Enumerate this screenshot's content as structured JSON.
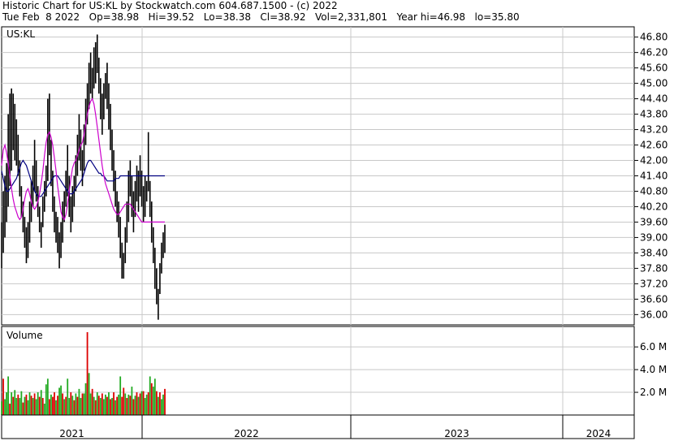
{
  "header": {
    "title": "Historic Chart for US:KL by Stockwatch.com 604.687.1500 - (c) 2022",
    "quote": "Tue Feb  8 2022   Op=38.98   Hi=39.52   Lo=38.38   Cl=38.92   Vol=2,331,801   Year hi=46.98   lo=35.80"
  },
  "colors": {
    "price": "#000000",
    "ma_short": "#cc00cc",
    "ma_long": "#000080",
    "vol_up": "#22aa22",
    "vol_down": "#dd0000",
    "grid": "#c8c8c8",
    "border": "#000000"
  },
  "chart_data": [
    {
      "type": "line",
      "title": "US:KL",
      "y_ticks": [
        "46.80",
        "46.20",
        "45.60",
        "45.00",
        "44.40",
        "43.80",
        "43.20",
        "42.60",
        "42.00",
        "41.40",
        "40.80",
        "40.20",
        "39.60",
        "39.00",
        "38.40",
        "37.80",
        "37.20",
        "36.60",
        "36.00"
      ],
      "ylim": [
        35.6,
        47.2
      ],
      "x_categories": [
        "2021",
        "2022",
        "2023",
        "2024"
      ],
      "grid": true,
      "series": [
        {
          "role": "price_range",
          "values": [
            [
              37.8,
              39.6
            ],
            [
              38.4,
              40.8
            ],
            [
              39.0,
              41.4
            ],
            [
              39.6,
              41.9
            ],
            [
              40.2,
              43.8
            ],
            [
              41.0,
              44.6
            ],
            [
              41.6,
              44.8
            ],
            [
              42.4,
              44.6
            ],
            [
              42.0,
              44.2
            ],
            [
              41.8,
              43.6
            ],
            [
              41.4,
              43.0
            ],
            [
              40.6,
              42.0
            ],
            [
              39.8,
              41.0
            ],
            [
              39.2,
              40.4
            ],
            [
              38.6,
              39.8
            ],
            [
              38.0,
              39.4
            ],
            [
              38.2,
              39.6
            ],
            [
              38.8,
              40.4
            ],
            [
              39.6,
              41.2
            ],
            [
              40.2,
              41.8
            ],
            [
              40.8,
              42.8
            ],
            [
              40.4,
              42.0
            ],
            [
              39.8,
              41.0
            ],
            [
              39.2,
              40.2
            ],
            [
              38.6,
              39.6
            ],
            [
              39.4,
              40.6
            ],
            [
              40.0,
              41.2
            ],
            [
              40.6,
              41.8
            ],
            [
              41.2,
              44.4
            ],
            [
              42.2,
              44.6
            ],
            [
              41.0,
              42.8
            ],
            [
              40.0,
              41.6
            ],
            [
              39.2,
              40.6
            ],
            [
              38.8,
              40.0
            ],
            [
              38.4,
              39.8
            ],
            [
              37.8,
              39.2
            ],
            [
              38.2,
              39.6
            ],
            [
              38.8,
              40.4
            ],
            [
              39.6,
              40.8
            ],
            [
              40.2,
              41.6
            ],
            [
              40.6,
              42.6
            ],
            [
              39.8,
              41.4
            ],
            [
              39.2,
              40.6
            ],
            [
              39.6,
              41.0
            ],
            [
              40.2,
              41.4
            ],
            [
              40.8,
              42.2
            ],
            [
              41.4,
              43.0
            ],
            [
              42.0,
              43.8
            ],
            [
              41.6,
              43.2
            ],
            [
              41.0,
              42.4
            ],
            [
              41.6,
              43.4
            ],
            [
              42.6,
              44.4
            ],
            [
              43.4,
              45.0
            ],
            [
              44.0,
              45.8
            ],
            [
              44.6,
              46.2
            ],
            [
              44.4,
              45.6
            ],
            [
              44.8,
              46.4
            ],
            [
              45.0,
              46.6
            ],
            [
              45.4,
              46.9
            ],
            [
              44.6,
              46.0
            ],
            [
              43.6,
              45.2
            ],
            [
              43.0,
              44.6
            ],
            [
              43.6,
              45.0
            ],
            [
              44.4,
              45.4
            ],
            [
              44.0,
              45.8
            ],
            [
              43.2,
              45.0
            ],
            [
              42.4,
              44.2
            ],
            [
              41.6,
              43.2
            ],
            [
              40.8,
              42.4
            ],
            [
              40.2,
              41.6
            ],
            [
              39.6,
              40.8
            ],
            [
              39.0,
              40.4
            ],
            [
              38.2,
              39.8
            ],
            [
              37.4,
              38.8
            ],
            [
              37.4,
              38.4
            ],
            [
              38.0,
              39.4
            ],
            [
              38.8,
              40.4
            ],
            [
              39.6,
              41.6
            ],
            [
              40.6,
              42.0
            ],
            [
              39.8,
              41.4
            ],
            [
              39.2,
              40.8
            ],
            [
              39.8,
              41.2
            ],
            [
              40.4,
              41.8
            ],
            [
              40.0,
              41.6
            ],
            [
              40.6,
              42.2
            ],
            [
              40.2,
              41.6
            ],
            [
              39.6,
              41.0
            ],
            [
              39.8,
              41.4
            ],
            [
              40.4,
              41.2
            ],
            [
              40.8,
              43.1
            ],
            [
              39.8,
              41.2
            ],
            [
              38.8,
              40.4
            ],
            [
              38.0,
              39.4
            ],
            [
              37.0,
              38.6
            ],
            [
              36.4,
              37.8
            ],
            [
              35.8,
              37.0
            ],
            [
              36.8,
              38.0
            ],
            [
              37.6,
              38.8
            ],
            [
              38.2,
              39.2
            ],
            [
              38.4,
              39.5
            ]
          ]
        },
        {
          "role": "moving_average_short",
          "values": [
            41.8,
            42.4,
            42.6,
            42.3,
            41.9,
            41.4,
            40.9,
            40.5,
            40.2,
            40.0,
            39.8,
            39.7,
            39.8,
            40.1,
            40.5,
            40.8,
            40.9,
            40.7,
            40.4,
            40.2,
            40.1,
            40.2,
            40.4,
            40.7,
            41.1,
            41.6,
            42.2,
            42.7,
            43.0,
            43.1,
            42.9,
            42.6,
            42.1,
            41.6,
            41.0,
            40.5,
            40.0,
            39.8,
            39.7,
            39.9,
            40.3,
            40.8,
            41.3,
            41.7,
            41.9,
            42.0,
            42.2,
            42.4,
            42.6,
            42.7,
            43.0,
            43.4,
            43.8,
            44.1,
            44.3,
            44.4,
            44.2,
            43.8,
            43.3,
            42.8,
            42.3,
            41.8,
            41.4,
            41.1,
            40.9,
            40.7,
            40.5,
            40.3,
            40.1,
            40.0,
            39.9,
            39.9,
            40.0,
            40.1,
            40.2,
            40.3,
            40.3,
            40.3,
            40.3,
            40.2,
            40.1,
            40.0,
            39.9,
            39.8,
            39.7,
            39.6,
            39.6,
            39.6,
            39.6,
            39.6,
            39.6,
            39.6,
            39.6,
            39.6,
            39.6,
            39.6,
            39.6,
            39.6,
            39.6,
            39.6
          ]
        },
        {
          "role": "moving_average_long",
          "values": [
            41.6,
            41.3,
            41.0,
            40.8,
            40.8,
            40.9,
            41.0,
            41.1,
            41.2,
            41.3,
            41.5,
            41.7,
            41.9,
            42.0,
            41.9,
            41.8,
            41.6,
            41.4,
            41.2,
            41.0,
            40.8,
            40.7,
            40.6,
            40.6,
            40.6,
            40.7,
            40.8,
            40.9,
            41.0,
            41.1,
            41.2,
            41.3,
            41.4,
            41.4,
            41.4,
            41.3,
            41.2,
            41.1,
            41.0,
            40.9,
            40.8,
            40.7,
            40.7,
            40.7,
            40.8,
            40.9,
            41.0,
            41.1,
            41.2,
            41.3,
            41.5,
            41.7,
            41.9,
            42.0,
            42.0,
            41.9,
            41.8,
            41.7,
            41.6,
            41.5,
            41.5,
            41.4,
            41.4,
            41.3,
            41.2,
            41.2,
            41.2,
            41.2,
            41.2,
            41.3,
            41.3,
            41.3,
            41.4,
            41.4,
            41.4,
            41.4,
            41.4,
            41.4,
            41.4,
            41.4,
            41.4,
            41.4,
            41.4,
            41.4,
            41.4,
            41.4,
            41.4,
            41.4,
            41.4,
            41.4,
            41.4,
            41.4,
            41.4,
            41.4,
            41.4,
            41.4,
            41.4,
            41.4,
            41.4,
            41.4
          ]
        }
      ]
    },
    {
      "type": "bar",
      "title": "Volume",
      "y_ticks": [
        "6.0 M",
        "4.0 M",
        "2.0 M"
      ],
      "ylim": [
        0,
        7.8
      ],
      "series": [
        {
          "role": "volume",
          "values": [
            1.2,
            3.2,
            1.4,
            2.0,
            3.4,
            1.0,
            2.0,
            1.6,
            2.2,
            1.5,
            1.8,
            1.5,
            2.1,
            1.1,
            1.6,
            1.8,
            1.3,
            2.0,
            1.7,
            1.5,
            1.9,
            1.4,
            2.0,
            1.6,
            2.2,
            1.5,
            1.0,
            2.7,
            3.2,
            1.4,
            1.8,
            1.6,
            2.0,
            1.3,
            1.7,
            2.4,
            2.6,
            1.9,
            1.4,
            1.6,
            3.2,
            1.5,
            2.0,
            1.7,
            1.3,
            1.9,
            1.6,
            2.3,
            1.5,
            1.9,
            1.9,
            2.8,
            7.3,
            3.7,
            1.9,
            2.3,
            1.6,
            1.3,
            2.0,
            1.7,
            1.5,
            1.9,
            1.4,
            1.8,
            1.6,
            2.0,
            1.4,
            1.5,
            2.0,
            1.3,
            1.6,
            1.8,
            3.4,
            1.6,
            2.4,
            1.9,
            1.5,
            1.8,
            1.7,
            2.5,
            1.4,
            1.7,
            2.0,
            1.6,
            1.9,
            2.1,
            2.1,
            1.5,
            1.8,
            2.0,
            3.4,
            2.8,
            2.5,
            3.2,
            2.1,
            1.6,
            2.0,
            1.4,
            1.8,
            2.3
          ],
          "up": [
            1,
            0,
            1,
            1,
            1,
            0,
            1,
            0,
            1,
            1,
            0,
            1,
            1,
            0,
            1,
            0,
            1,
            1,
            0,
            1,
            0,
            1,
            1,
            0,
            1,
            0,
            1,
            1,
            1,
            0,
            1,
            0,
            0,
            1,
            0,
            1,
            1,
            0,
            1,
            0,
            1,
            1,
            0,
            1,
            0,
            1,
            0,
            1,
            1,
            0,
            1,
            1,
            0,
            1,
            1,
            0,
            1,
            0,
            1,
            0,
            1,
            0,
            1,
            1,
            0,
            1,
            0,
            1,
            0,
            1,
            0,
            1,
            1,
            0,
            0,
            1,
            0,
            1,
            0,
            1,
            0,
            1,
            0,
            1,
            0,
            1,
            0,
            1,
            1,
            0,
            1,
            0,
            1,
            1,
            0,
            1,
            0,
            1,
            1,
            0
          ]
        }
      ]
    }
  ]
}
